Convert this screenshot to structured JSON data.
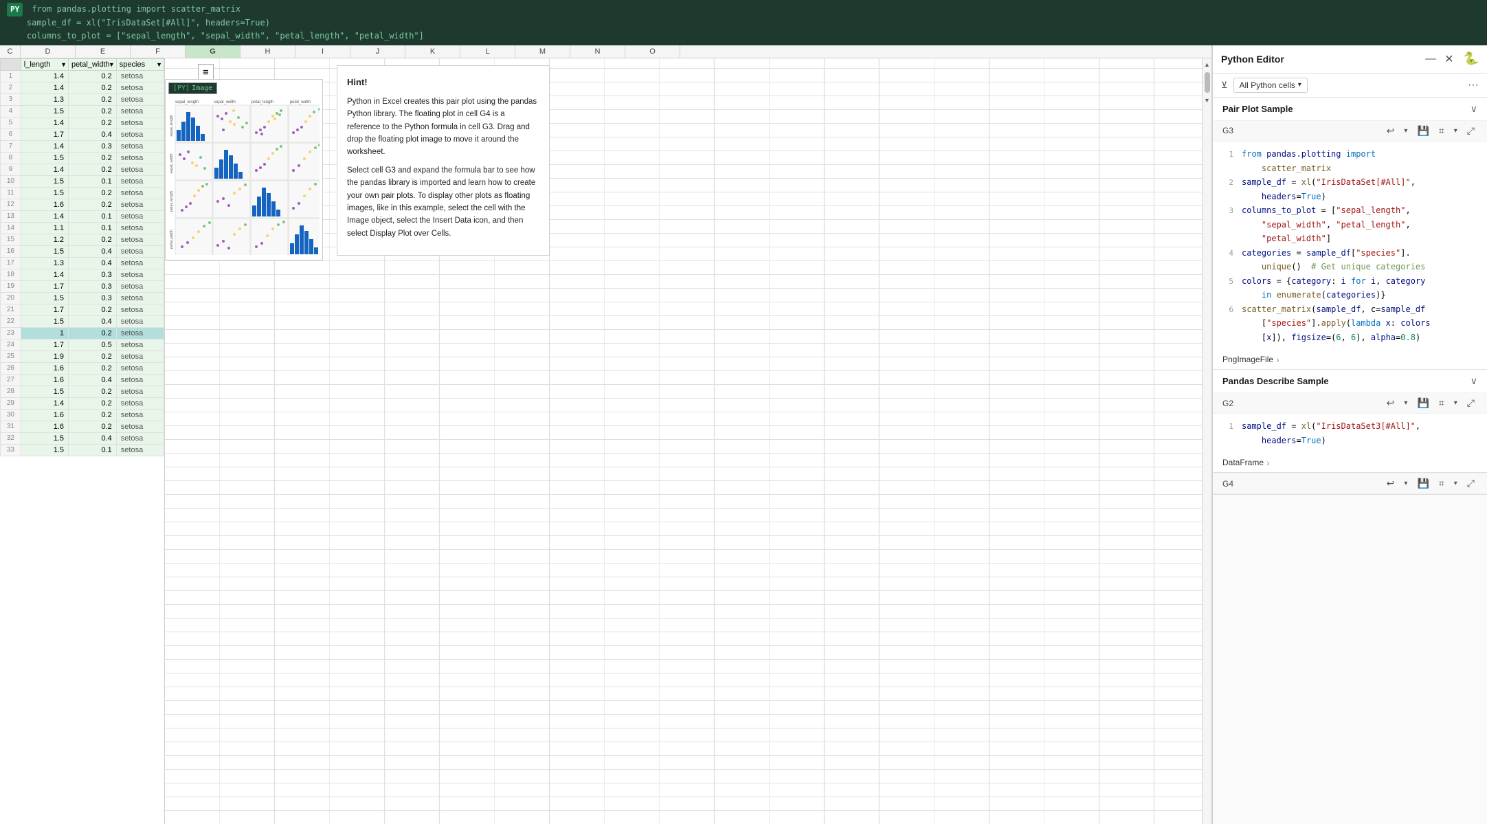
{
  "formula_bar": {
    "py_badge": "PY",
    "lines": [
      "from pandas.plotting import scatter_matrix",
      "sample_df = xl(\"IrisDataSet[#All]\", headers=True)",
      "columns_to_plot = [\"sepal_length\", \"sepal_width\", \"petal_length\", \"petal_width\"]"
    ]
  },
  "spreadsheet": {
    "col_headers": [
      "C",
      "D",
      "E",
      "F",
      "G",
      "H",
      "I",
      "J",
      "K",
      "L",
      "M",
      "N",
      "O"
    ],
    "table_headers": [
      "l_length",
      "petal_width",
      "species"
    ],
    "rows": [
      [
        "1.4",
        "0.2",
        "setosa"
      ],
      [
        "1.4",
        "0.2",
        "setosa"
      ],
      [
        "1.3",
        "0.2",
        "setosa"
      ],
      [
        "1.5",
        "0.2",
        "setosa"
      ],
      [
        "1.4",
        "0.2",
        "setosa"
      ],
      [
        "1.7",
        "0.4",
        "setosa"
      ],
      [
        "1.4",
        "0.3",
        "setosa"
      ],
      [
        "1.5",
        "0.2",
        "setosa"
      ],
      [
        "1.4",
        "0.2",
        "setosa"
      ],
      [
        "1.5",
        "0.1",
        "setosa"
      ],
      [
        "1.5",
        "0.2",
        "setosa"
      ],
      [
        "1.6",
        "0.2",
        "setosa"
      ],
      [
        "1.4",
        "0.1",
        "setosa"
      ],
      [
        "1.1",
        "0.1",
        "setosa"
      ],
      [
        "1.2",
        "0.2",
        "setosa"
      ],
      [
        "1.5",
        "0.4",
        "setosa"
      ],
      [
        "1.3",
        "0.4",
        "setosa"
      ],
      [
        "1.4",
        "0.3",
        "setosa"
      ],
      [
        "1.7",
        "0.3",
        "setosa"
      ],
      [
        "1.5",
        "0.3",
        "setosa"
      ],
      [
        "1.7",
        "0.2",
        "setosa"
      ],
      [
        "1.5",
        "0.4",
        "setosa"
      ],
      [
        "1",
        "0.2",
        "setosa"
      ],
      [
        "1.7",
        "0.5",
        "setosa"
      ],
      [
        "1.9",
        "0.2",
        "setosa"
      ],
      [
        "1.6",
        "0.2",
        "setosa"
      ],
      [
        "1.6",
        "0.4",
        "setosa"
      ],
      [
        "1.5",
        "0.2",
        "setosa"
      ],
      [
        "1.4",
        "0.2",
        "setosa"
      ],
      [
        "1.6",
        "0.2",
        "setosa"
      ],
      [
        "1.6",
        "0.2",
        "setosa"
      ],
      [
        "1.5",
        "0.4",
        "setosa"
      ],
      [
        "1.5",
        "0.1",
        "setosa"
      ]
    ]
  },
  "pair_plot": {
    "cell_ref": "Image",
    "py_bracket": "[PY]",
    "insert_icon": "≡",
    "axis_labels": [
      "sepal_length",
      "sepal_width",
      "petal_length",
      "petal_width"
    ]
  },
  "hint_box": {
    "title": "Hint!",
    "paragraphs": [
      "Python in Excel creates this pair plot using the pandas Python library. The floating plot in cell G4 is a reference to the Python formula in cell G3. Drag and drop the floating plot image to move it around the worksheet.",
      "Select cell G3 and expand the formula bar to see how the pandas library is imported and learn how to create your own pair plots. To display other plots as floating images, like in this example, select the cell with the Image object, select the Insert Data icon, and then select Display Plot over Cells."
    ]
  },
  "python_editor": {
    "title": "Python Editor",
    "close_icon": "✕",
    "minimize_icon": "—",
    "filter_label": "All Python cells",
    "more_icon": "···",
    "groups": [
      {
        "title": "Pair Plot Sample",
        "cell_ref": "G3",
        "expanded": true,
        "code_lines": [
          {
            "num": 1,
            "code": "from pandas.plotting import",
            "tokens": [
              {
                "type": "kw",
                "text": "from"
              },
              {
                "type": "var",
                "text": " pandas.plotting "
              },
              {
                "type": "kw",
                "text": "import"
              }
            ],
            "rest": ""
          },
          {
            "num": "",
            "code": "    scatter_matrix",
            "tokens": [
              {
                "type": "fn",
                "text": "    scatter_matrix"
              }
            ],
            "rest": ""
          },
          {
            "num": 2,
            "code": "sample_df = xl(\"IrisDataSet[#All]\",",
            "tokens": [
              {
                "type": "var",
                "text": "sample_df"
              },
              {
                "type": "punc",
                "text": " = "
              },
              {
                "type": "fn",
                "text": "xl"
              },
              {
                "type": "punc",
                "text": "("
              },
              {
                "type": "str",
                "text": "\"IrisDataSet[#All]\""
              },
              {
                "type": "punc",
                "text": ","
              }
            ],
            "rest": ""
          },
          {
            "num": "",
            "code": "    headers=True)",
            "tokens": [
              {
                "type": "var",
                "text": "    headers"
              },
              {
                "type": "punc",
                "text": "="
              },
              {
                "type": "kw",
                "text": "True"
              },
              {
                "type": "punc",
                "text": ")"
              }
            ],
            "rest": ""
          },
          {
            "num": 3,
            "code": "columns_to_plot = [\"sepal_length\",",
            "tokens": [
              {
                "type": "var",
                "text": "columns_to_plot"
              },
              {
                "type": "punc",
                "text": " = ["
              },
              {
                "type": "str",
                "text": "\"sepal_length\""
              },
              {
                "type": "punc",
                "text": ","
              }
            ],
            "rest": ""
          },
          {
            "num": "",
            "code": "    \"sepal_width\", \"petal_length\",",
            "tokens": [
              {
                "type": "str",
                "text": "    \"sepal_width\""
              },
              {
                "type": "punc",
                "text": ", "
              },
              {
                "type": "str",
                "text": "\"petal_length\""
              },
              {
                "type": "punc",
                "text": ","
              }
            ],
            "rest": ""
          },
          {
            "num": "",
            "code": "    \"petal_width\"]",
            "tokens": [
              {
                "type": "str",
                "text": "    \"petal_width\""
              },
              {
                "type": "punc",
                "text": "]"
              }
            ],
            "rest": ""
          },
          {
            "num": 4,
            "code": "categories = sample_df[\"species\"].",
            "tokens": [
              {
                "type": "var",
                "text": "categories"
              },
              {
                "type": "punc",
                "text": " = "
              },
              {
                "type": "var",
                "text": "sample_df"
              },
              {
                "type": "punc",
                "text": "["
              },
              {
                "type": "str",
                "text": "\"species\""
              },
              {
                "type": "punc",
                "text": "]."
              }
            ],
            "rest": ""
          },
          {
            "num": "",
            "code": "    unique()  # Get unique categories",
            "tokens": [
              {
                "type": "fn",
                "text": "    unique"
              },
              {
                "type": "punc",
                "text": "()  "
              },
              {
                "type": "cm",
                "text": "# Get unique categories"
              }
            ],
            "rest": ""
          },
          {
            "num": 5,
            "code": "colors = {category: i for i, category",
            "tokens": [
              {
                "type": "var",
                "text": "colors"
              },
              {
                "type": "punc",
                "text": " = {"
              },
              {
                "type": "var",
                "text": "category"
              },
              {
                "type": "punc",
                "text": ": "
              },
              {
                "type": "var",
                "text": "i"
              },
              {
                "type": "kw",
                "text": " for "
              },
              {
                "type": "var",
                "text": "i"
              },
              {
                "type": "punc",
                "text": ", "
              },
              {
                "type": "var",
                "text": "category"
              }
            ],
            "rest": ""
          },
          {
            "num": "",
            "code": "    in enumerate(categories)}",
            "tokens": [
              {
                "type": "kw",
                "text": "    in "
              },
              {
                "type": "fn",
                "text": "enumerate"
              },
              {
                "type": "punc",
                "text": "("
              },
              {
                "type": "var",
                "text": "categories"
              },
              {
                "type": "punc",
                "text": ")}"
              }
            ],
            "rest": ""
          },
          {
            "num": 6,
            "code": "scatter_matrix(sample_df, c=sample_df",
            "tokens": [
              {
                "type": "fn",
                "text": "scatter_matrix"
              },
              {
                "type": "punc",
                "text": "("
              },
              {
                "type": "var",
                "text": "sample_df"
              },
              {
                "type": "punc",
                "text": ", c="
              },
              {
                "type": "var",
                "text": "sample_df"
              }
            ],
            "rest": ""
          },
          {
            "num": "",
            "code": "    [\"species\"].apply(lambda x: colors",
            "tokens": [
              {
                "type": "punc",
                "text": "    ["
              },
              {
                "type": "str",
                "text": "\"species\""
              },
              {
                "type": "punc",
                "text": "]."
              },
              {
                "type": "fn",
                "text": "apply"
              },
              {
                "type": "punc",
                "text": "("
              },
              {
                "type": "kw",
                "text": "lambda"
              },
              {
                "type": "var",
                "text": " x"
              },
              {
                "type": "punc",
                "text": ": "
              },
              {
                "type": "var",
                "text": "colors"
              }
            ],
            "rest": ""
          },
          {
            "num": "",
            "code": "    [x]), figsize=(6, 6), alpha=0.8)",
            "tokens": [
              {
                "type": "punc",
                "text": "    ["
              },
              {
                "type": "var",
                "text": "x"
              },
              {
                "type": "punc",
                "text": "]), "
              },
              {
                "type": "var",
                "text": "figsize"
              },
              {
                "type": "punc",
                "text": "=("
              },
              {
                "type": "num",
                "text": "6"
              },
              {
                "type": "punc",
                "text": ", "
              },
              {
                "type": "num",
                "text": "6"
              },
              {
                "type": "punc",
                "text": "), "
              },
              {
                "type": "var",
                "text": "alpha"
              },
              {
                "type": "punc",
                "text": "="
              },
              {
                "type": "num",
                "text": "0.8"
              },
              {
                "type": "punc",
                "text": ")"
              }
            ],
            "rest": ""
          }
        ],
        "output_label": "PngImageFile",
        "output_arrow": "›"
      },
      {
        "title": "Pandas Describe Sample",
        "cell_ref": "G2",
        "expanded": true,
        "code_lines": [
          {
            "num": 1,
            "code": "sample_df = xl(\"IrisDataSet3[#All]\",",
            "tokens": [
              {
                "type": "var",
                "text": "sample_df"
              },
              {
                "type": "punc",
                "text": " = "
              },
              {
                "type": "fn",
                "text": "xl"
              },
              {
                "type": "punc",
                "text": "("
              },
              {
                "type": "str",
                "text": "\"IrisDataSet3[#All]\""
              },
              {
                "type": "punc",
                "text": ","
              }
            ],
            "rest": ""
          },
          {
            "num": "",
            "code": "    headers=True)",
            "tokens": [
              {
                "type": "var",
                "text": "    headers"
              },
              {
                "type": "punc",
                "text": "="
              },
              {
                "type": "kw",
                "text": "True"
              },
              {
                "type": "punc",
                "text": ")"
              }
            ],
            "rest": ""
          }
        ],
        "output_label": "DataFrame",
        "output_arrow": "›"
      },
      {
        "title": "G4",
        "cell_ref": "G4",
        "expanded": false,
        "code_lines": [],
        "output_label": "",
        "output_arrow": ""
      }
    ]
  }
}
